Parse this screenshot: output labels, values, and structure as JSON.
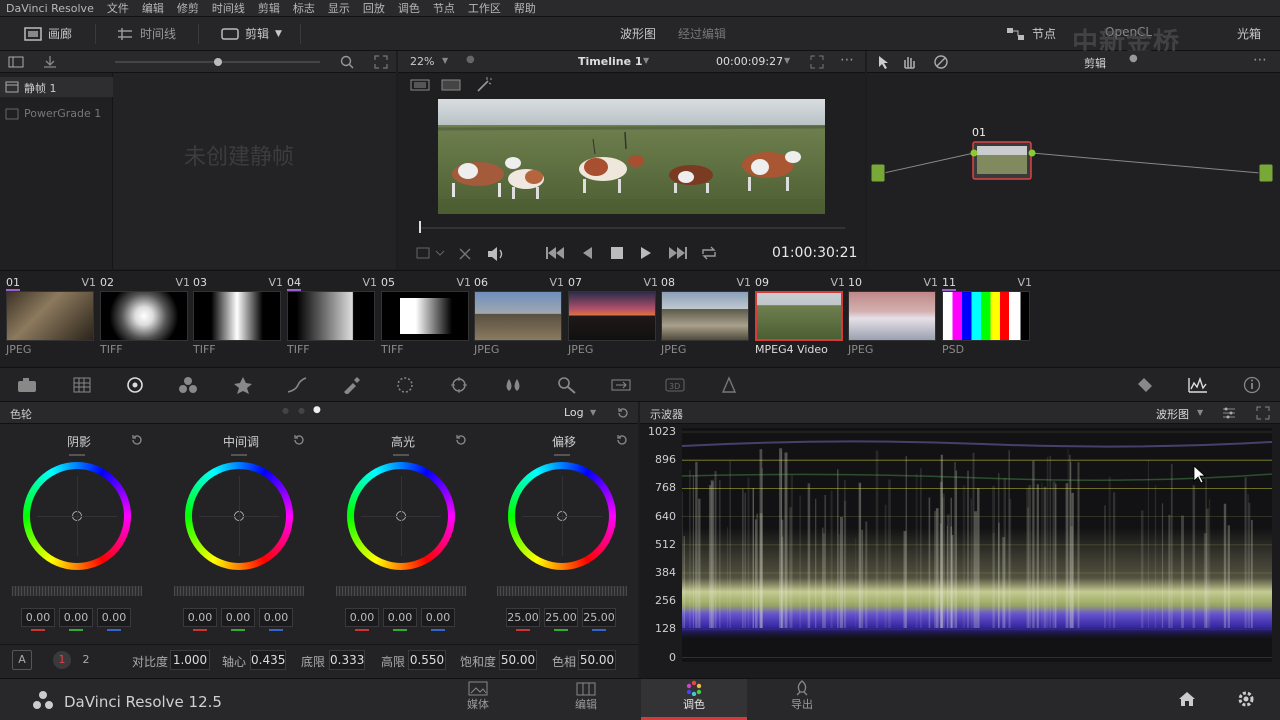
{
  "menubar": {
    "app": "DaVinci Resolve",
    "items": [
      "文件",
      "编辑",
      "修剪",
      "时间线",
      "剪辑",
      "标志",
      "显示",
      "回放",
      "调色",
      "节点",
      "工作区",
      "帮助"
    ]
  },
  "toolbar": {
    "gallery": "画廊",
    "timeline": "时间线",
    "clips": "剪辑",
    "scope_view": "波形图",
    "processed": "经过编辑",
    "nodes": "节点",
    "opencl": "OpenCL",
    "lightbox": "光箱"
  },
  "gallery": {
    "album1": "静帧 1",
    "album2": "PowerGrade 1",
    "empty": "未创建静帧"
  },
  "viewer": {
    "zoom": "22%",
    "timeline_name": "Timeline 1",
    "timecode_top": "00:00:09:27",
    "timecode": "01:00:30:21"
  },
  "node_editor": {
    "mode": "剪辑",
    "node_label": "01"
  },
  "clips": [
    {
      "num": "01",
      "track": "V1",
      "format": "JPEG"
    },
    {
      "num": "02",
      "track": "V1",
      "format": "TIFF"
    },
    {
      "num": "03",
      "track": "V1",
      "format": "TIFF"
    },
    {
      "num": "04",
      "track": "V1",
      "format": "TIFF"
    },
    {
      "num": "05",
      "track": "V1",
      "format": "TIFF"
    },
    {
      "num": "06",
      "track": "V1",
      "format": "JPEG"
    },
    {
      "num": "07",
      "track": "V1",
      "format": "JPEG"
    },
    {
      "num": "08",
      "track": "V1",
      "format": "JPEG"
    },
    {
      "num": "09",
      "track": "V1",
      "format": "MPEG4 Video"
    },
    {
      "num": "10",
      "track": "V1",
      "format": "JPEG"
    },
    {
      "num": "11",
      "track": "V1",
      "format": "PSD"
    }
  ],
  "color_wheels": {
    "title": "色轮",
    "mode": "Log",
    "wheels": [
      {
        "label": "阴影",
        "values": [
          "0.00",
          "0.00",
          "0.00"
        ]
      },
      {
        "label": "中间调",
        "values": [
          "0.00",
          "0.00",
          "0.00"
        ]
      },
      {
        "label": "高光",
        "values": [
          "0.00",
          "0.00",
          "0.00"
        ]
      },
      {
        "label": "偏移",
        "values": [
          "25.00",
          "25.00",
          "25.00"
        ]
      }
    ],
    "page_a": "A",
    "page1": "1",
    "page2": "2",
    "contrast_label": "对比度",
    "contrast": "1.000",
    "pivot_label": "轴心",
    "pivot": "0.435",
    "low_label": "底限",
    "low": "0.333",
    "high_label": "高限",
    "high": "0.550",
    "sat_label": "饱和度",
    "sat": "50.00",
    "hue_label": "色相",
    "hue": "50.00"
  },
  "scopes": {
    "title": "示波器",
    "mode": "波形图",
    "ticks": [
      "1023",
      "896",
      "768",
      "640",
      "512",
      "384",
      "256",
      "128",
      "0"
    ]
  },
  "bottom": {
    "app_version": "DaVinci Resolve 12.5",
    "nav": [
      "媒体",
      "编辑",
      "调色",
      "导出"
    ],
    "active_nav": "调色"
  },
  "colors": {
    "accent": "#d43c3c",
    "wheel_bg": "#232325"
  }
}
